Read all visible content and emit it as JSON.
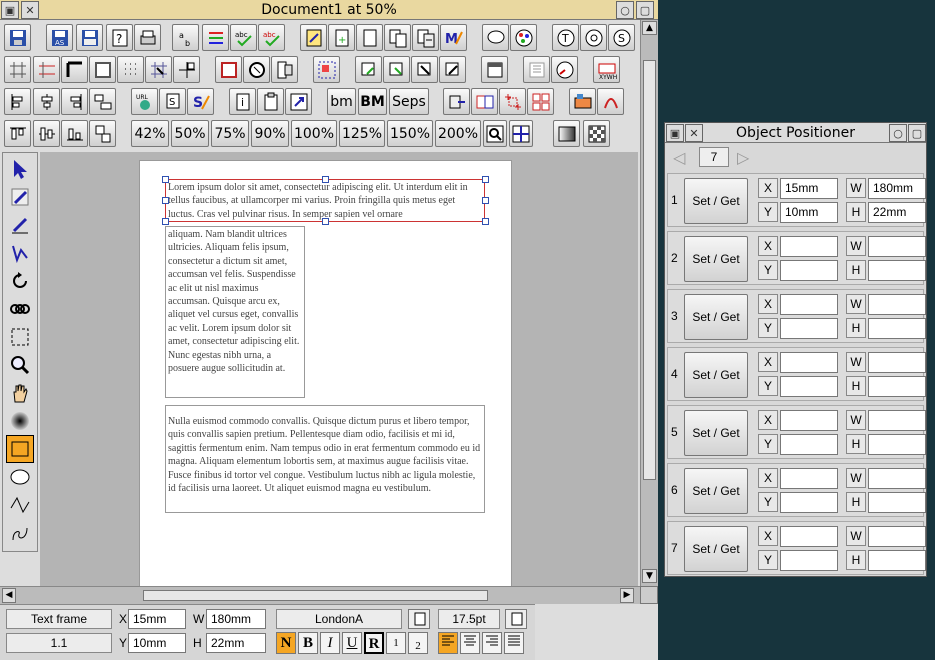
{
  "doc_window": {
    "title": "Document1 at 50%",
    "zoom_buttons": [
      "42%",
      "50%",
      "75%",
      "90%",
      "100%",
      "125%",
      "150%",
      "200%"
    ],
    "text_buttons": {
      "bm_lower": "bm",
      "bm_upper": "BM",
      "seps": "Seps"
    }
  },
  "page": {
    "frame1_text": "Lorem ipsum dolor sit amet, consectetur adipiscing elit. Ut interdum elit in tellus faucibus, at ullamcorper mi varius. Proin fringilla quis metus eget luctus. Cras vel pulvinar risus. In semper sapien vel ornare",
    "frame2_text": "aliquam. Nam blandit ultrices ultricies. Aliquam felis ipsum, consectetur a dictum sit amet, accumsan vel felis. Suspendisse ac elit ut nisl maximus accumsan. Quisque arcu ex, aliquet vel cursus eget, convallis ac velit. Lorem ipsum dolor sit amet, consectetur adipiscing elit. Nunc egestas nibh urna, a posuere augue sollicitudin at.",
    "frame3_text": "Nulla euismod commodo convallis. Quisque dictum purus et libero tempor, quis convallis sapien pretium. Pellentesque diam odio, facilisis et mi id, sagittis fermentum enim. Nam tempus odio in erat fermentum commodo eu id magna. Aliquam elementum lobortis sem, at maximus augue facilisis vitae. Fusce finibus id tortor vel congue. Vestibulum luctus nibh ac ligula molestie, id facilisis urna laoreet. Ut aliquet euismod magna eu vestibulum."
  },
  "status": {
    "object_type": "Text frame",
    "object_id": "1.1",
    "x_label": "X",
    "x_value": "15mm",
    "y_label": "Y",
    "y_value": "10mm",
    "w_label": "W",
    "w_value": "180mm",
    "h_label": "H",
    "h_value": "22mm",
    "font_name": "LondonA",
    "font_size": "17.5pt",
    "style_buttons": [
      "N",
      "B",
      "I",
      "U",
      "R",
      "1",
      "2"
    ]
  },
  "positioner": {
    "title": "Object Positioner",
    "count": "7",
    "set_get_label": "Set / Get",
    "labels": {
      "x": "X",
      "y": "Y",
      "w": "W",
      "h": "H"
    },
    "rows": [
      {
        "num": "1",
        "x": "15mm",
        "y": "10mm",
        "w": "180mm",
        "h": "22mm"
      },
      {
        "num": "2",
        "x": "",
        "y": "",
        "w": "",
        "h": ""
      },
      {
        "num": "3",
        "x": "",
        "y": "",
        "w": "",
        "h": ""
      },
      {
        "num": "4",
        "x": "",
        "y": "",
        "w": "",
        "h": ""
      },
      {
        "num": "5",
        "x": "",
        "y": "",
        "w": "",
        "h": ""
      },
      {
        "num": "6",
        "x": "",
        "y": "",
        "w": "",
        "h": ""
      },
      {
        "num": "7",
        "x": "",
        "y": "",
        "w": "",
        "h": ""
      }
    ]
  },
  "colors": {
    "title_bar": "#e9d8a0",
    "desktop": "#17343d",
    "selected_tool": "#f5a623"
  }
}
